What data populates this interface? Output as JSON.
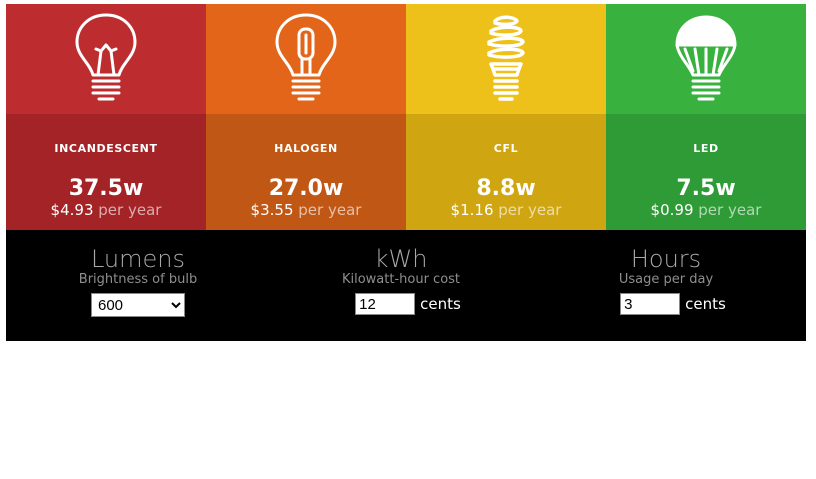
{
  "bulbs": [
    {
      "name": "INCANDESCENT",
      "watts": "37.5w",
      "cost": "$4.93",
      "per": "per year",
      "top_color": "#bd2d30",
      "bottom_color": "#a32327",
      "icon": "incandescent-bulb-icon"
    },
    {
      "name": "HALOGEN",
      "watts": "27.0w",
      "cost": "$3.55",
      "per": "per year",
      "top_color": "#e2651a",
      "bottom_color": "#c05714",
      "icon": "halogen-bulb-icon"
    },
    {
      "name": "CFL",
      "watts": "8.8w",
      "cost": "$1.16",
      "per": "per year",
      "top_color": "#eec01a",
      "bottom_color": "#cfa612",
      "icon": "cfl-bulb-icon"
    },
    {
      "name": "LED",
      "watts": "7.5w",
      "cost": "$0.99",
      "per": "per year",
      "top_color": "#38b13f",
      "bottom_color": "#2e9b36",
      "icon": "led-bulb-icon"
    }
  ],
  "controls": {
    "lumens": {
      "title": "Lumens",
      "subtitle": "Brightness of bulb",
      "selected": "600"
    },
    "kwh": {
      "title": "kWh",
      "subtitle": "Kilowatt-hour cost",
      "value": "12",
      "unit": "cents"
    },
    "hours": {
      "title": "Hours",
      "subtitle": "Usage per day",
      "value": "3",
      "unit": "cents"
    }
  }
}
